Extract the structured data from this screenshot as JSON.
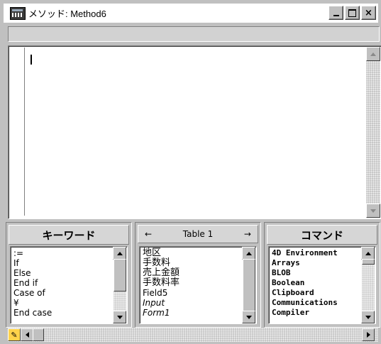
{
  "window": {
    "title": "メソッド: Method6",
    "icon": "database-app-icon",
    "controls": {
      "minimize": "minimize-icon",
      "maximize": "maximize-icon",
      "close": "×"
    }
  },
  "editor": {
    "content": ""
  },
  "keywords": {
    "header": "キーワード",
    "items": [
      ":=",
      "If",
      "Else",
      "End if",
      "Case of",
      "¥",
      "End case"
    ]
  },
  "table": {
    "header": "Table 1",
    "prev": "←",
    "next": "→",
    "items": [
      "地区",
      "手数料",
      "売上金額",
      "手数料率",
      "Field5",
      "Input",
      "Form1"
    ]
  },
  "commands": {
    "header": "コマンド",
    "items": [
      "4D Environment",
      "Arrays",
      "BLOB",
      "Boolean",
      "Clipboard",
      "Communications",
      "Compiler"
    ]
  },
  "statusbar": {
    "edit_mode_icon": "pencil-icon"
  },
  "colors": {
    "window_bg": "#c0c0c0",
    "titlebar_bg": "#ffffff",
    "editor_bg": "#ffffff"
  }
}
